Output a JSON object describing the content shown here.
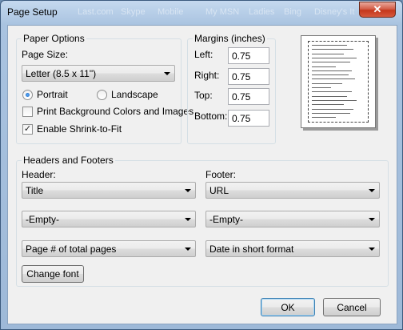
{
  "window": {
    "title": "Page Setup",
    "close_glyph": "✕",
    "background_ghost_tabs": [
      "Last.com",
      "Skype",
      "Mobile",
      "My MSN",
      "Ladies",
      "Bing",
      "Disney's It"
    ]
  },
  "paper_options": {
    "group_title": "Paper Options",
    "page_size_label": "Page Size:",
    "page_size_value": "Letter (8.5 x 11\")",
    "portrait_label": "Portrait",
    "portrait_checked": true,
    "landscape_label": "Landscape",
    "landscape_checked": false,
    "print_bg_label": "Print Background Colors and Images",
    "print_bg_checked": false,
    "shrink_label": "Enable Shrink-to-Fit",
    "shrink_checked": true,
    "check_glyph": "✓"
  },
  "margins": {
    "group_title": "Margins (inches)",
    "left_label": "Left:",
    "left_value": "0.75",
    "right_label": "Right:",
    "right_value": "0.75",
    "top_label": "Top:",
    "top_value": "0.75",
    "bottom_label": "Bottom:",
    "bottom_value": "0.75"
  },
  "headers_footers": {
    "group_title": "Headers and Footers",
    "header_label": "Header:",
    "footer_label": "Footer:",
    "header_1": "Title",
    "header_2": "-Empty-",
    "header_3": "Page # of total pages",
    "footer_1": "URL",
    "footer_2": "-Empty-",
    "footer_3": "Date in short format",
    "change_font_label": "Change font"
  },
  "buttons": {
    "ok_label": "OK",
    "cancel_label": "Cancel"
  },
  "colors": {
    "close_button": "#c4371c",
    "default_button_border": "#3c7fb1"
  }
}
